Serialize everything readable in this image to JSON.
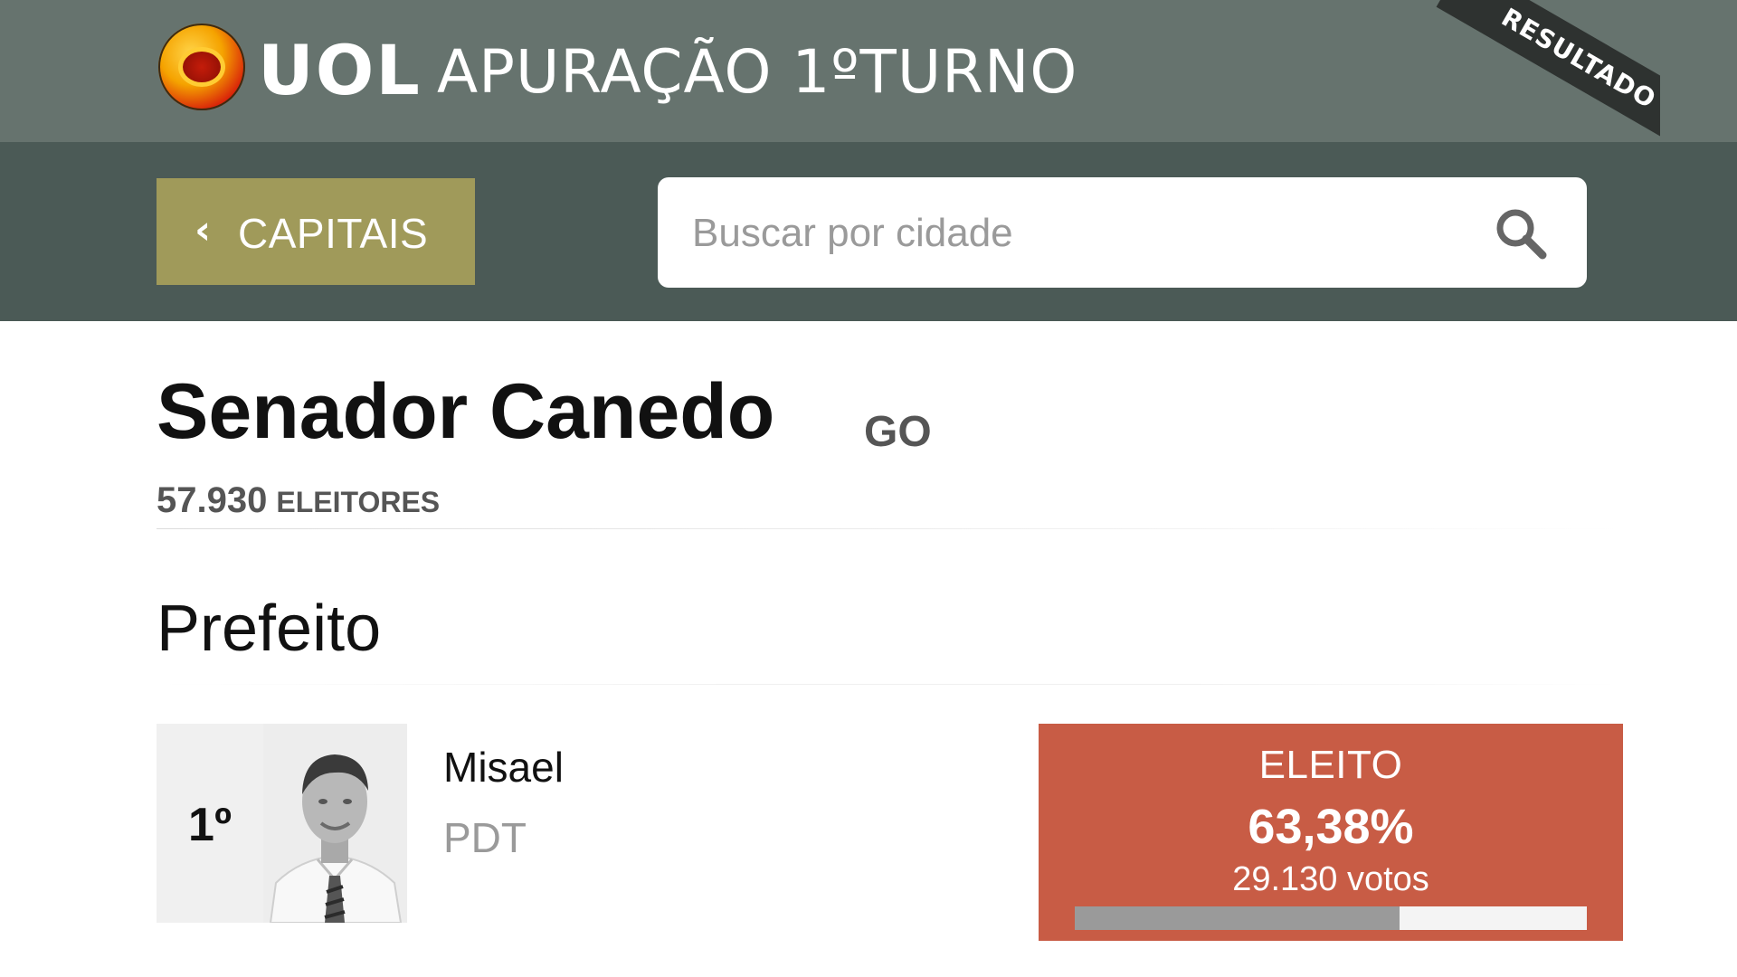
{
  "header": {
    "brand": "UOL",
    "title": "APURAÇÃO 1ºTURNO",
    "ribbon": "RESULTADO"
  },
  "nav": {
    "back_label": "CAPITAIS",
    "search_placeholder": "Buscar por cidade",
    "search_value": ""
  },
  "city": {
    "name": "Senador Canedo",
    "state": "GO",
    "voters_count": "57.930",
    "voters_label": "ELEITORES"
  },
  "section": {
    "title": "Prefeito"
  },
  "candidates": [
    {
      "rank": "1º",
      "name": "Misael",
      "party": "PDT",
      "status": "ELEITO",
      "percent_text": "63,38%",
      "votes_text": "29.130 votos",
      "percent_value": 63.38
    }
  ],
  "colors": {
    "brand_bar": "#66736e",
    "nav_bar": "#4b5a56",
    "back_button": "#a09a5a",
    "result_box": "#c85c45",
    "progress_fill": "#9a9a9a"
  },
  "icons": {
    "back": "chevron-left-icon",
    "search": "search-icon",
    "logo": "uol-logo-icon"
  }
}
